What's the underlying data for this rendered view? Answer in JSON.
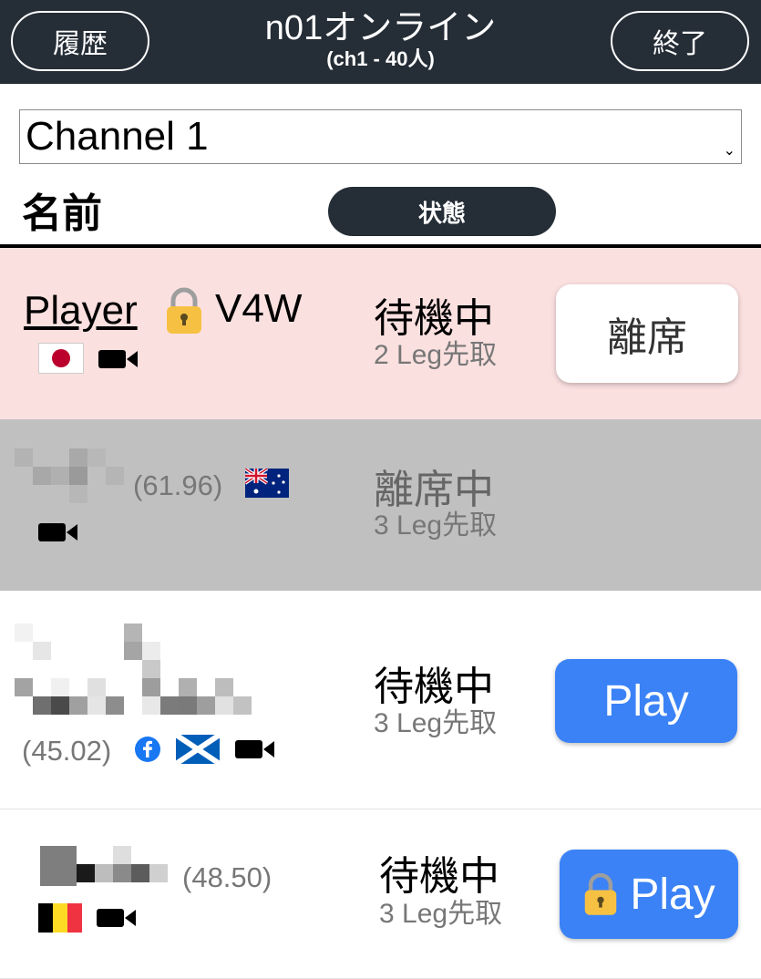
{
  "header": {
    "history_label": "履歴",
    "title": "n01オンライン",
    "subtitle": "(ch1 - 40人)",
    "exit_label": "終了"
  },
  "channel_select": {
    "value": "Channel 1"
  },
  "columns": {
    "name": "名前",
    "status": "状態"
  },
  "players": [
    {
      "name": "Player",
      "code": "V4W",
      "status": "待機中",
      "legs": "2 Leg先取",
      "button": "離席",
      "flag": "japan",
      "icons": [
        "lock-icon",
        "video-icon"
      ]
    },
    {
      "rating": "(61.96)",
      "status": "離席中",
      "legs": "3 Leg先取",
      "flag": "australia",
      "icons": [
        "video-icon"
      ]
    },
    {
      "rating": "(45.02)",
      "status": "待機中",
      "legs": "3 Leg先取",
      "button": "Play",
      "flag": "scotland",
      "icons": [
        "facebook-icon",
        "video-icon"
      ]
    },
    {
      "rating": "(48.50)",
      "status": "待機中",
      "legs": "3 Leg先取",
      "button": "Play",
      "flag": "belgium",
      "icons": [
        "video-icon",
        "lock-icon"
      ]
    }
  ],
  "colors": {
    "header_bg": "#252d36",
    "own_row_bg": "#fbe0e0",
    "away_row_bg": "#c0c0c0",
    "play_button": "#3b82f6"
  }
}
